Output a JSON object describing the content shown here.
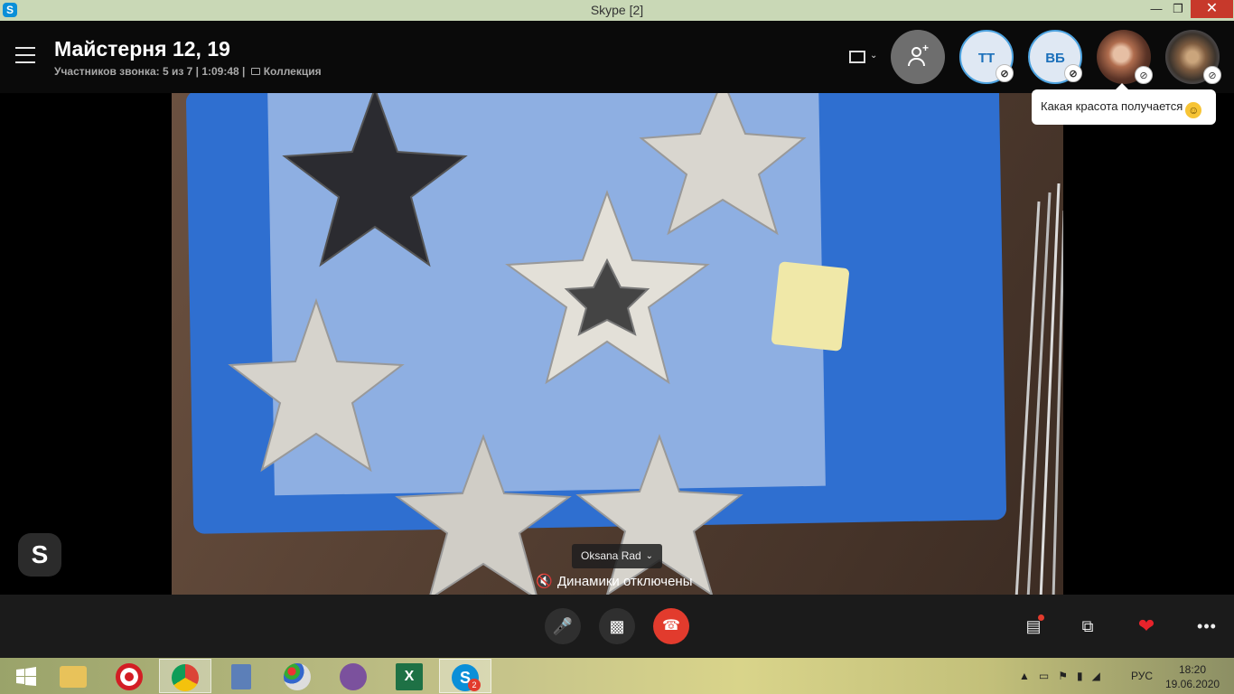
{
  "window": {
    "title": "Skype [2]",
    "app_icon": "S"
  },
  "header": {
    "title": "Майстерня 12, 19",
    "subtitle": "Участников звонка: 5 из 7 | 1:09:48 | ",
    "collection_label": "Коллекция",
    "participants": [
      {
        "initials": "ТТ"
      },
      {
        "initials": "ВБ"
      }
    ]
  },
  "chat_popup": {
    "text": "Какая красота получается"
  },
  "video": {
    "speaker_name": "Oksana Rad",
    "status_text": "Динамики отключены"
  },
  "watermark": {
    "letter": "S"
  },
  "taskbar": {
    "language": "РУС",
    "time": "18:20",
    "date": "19.06.2020",
    "skype_badge": "2"
  },
  "colors": {
    "end_call": "#e23b2d",
    "heart": "#e8232b",
    "mat_blue": "#2f6fd0",
    "titlebar": "#c9d8b6"
  }
}
